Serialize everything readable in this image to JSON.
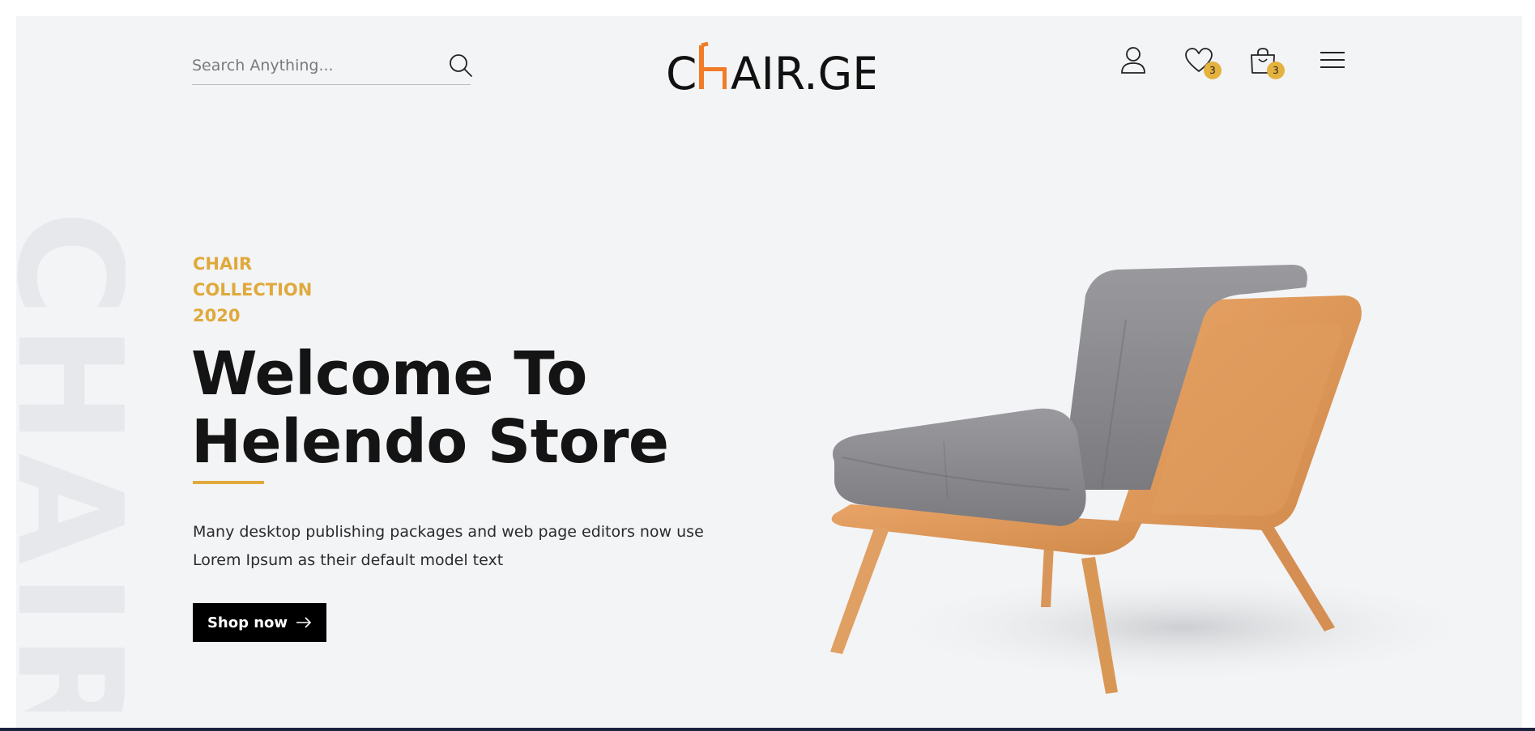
{
  "header": {
    "search": {
      "placeholder": "Search Anything...",
      "value": ""
    },
    "logo": {
      "prefix": "C",
      "highlight": "H",
      "suffix": "AIR.GE",
      "accent_color": "#f07c28"
    },
    "wishlist_count": "3",
    "cart_count": "3",
    "icons": [
      "search-icon",
      "user-icon",
      "heart-icon",
      "shopping-bag-icon",
      "hamburger-menu-icon"
    ]
  },
  "hero": {
    "watermark": "CHAIR",
    "eyebrow": [
      "CHAIR",
      "COLLECTION",
      "2020"
    ],
    "headline": [
      "Welcome To",
      "Helendo Store"
    ],
    "description": [
      "Many desktop publishing packages and web page editors now use",
      "Lorem Ipsum as their default model text"
    ],
    "cta_label": "Shop now"
  },
  "colors": {
    "background": "#f3f4f6",
    "accent": "#e0a93c",
    "badge": "#e4b23e",
    "text": "#141414",
    "button": "#000000"
  }
}
